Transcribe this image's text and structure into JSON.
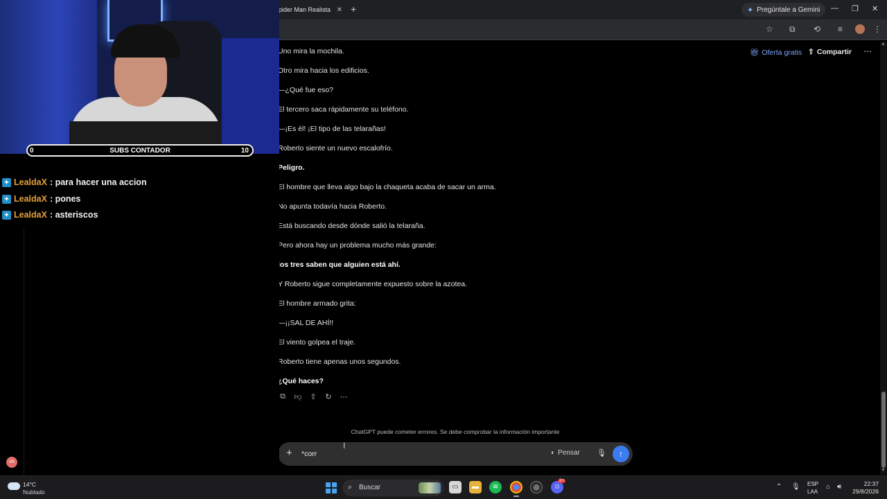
{
  "browser": {
    "tab_title": "pider Man Realista",
    "tab_close": "✕",
    "new_tab": "+",
    "gemini_label": "Pregúntale a Gemini",
    "minimize": "—",
    "maximize": "❐",
    "close": "✕"
  },
  "chat_page": {
    "header": {
      "offer_label": "Oferta gratis",
      "share_label": "Compartir",
      "more_label": "⋯"
    },
    "story_lines": [
      {
        "text": "Uno mira la mochila.",
        "bold": false
      },
      {
        "text": "Otro mira hacia los edificios.",
        "bold": false
      },
      {
        "text": "—¿Qué fue eso?",
        "bold": false
      },
      {
        "text": "El tercero saca rápidamente su teléfono.",
        "bold": false
      },
      {
        "text": "—¡Es él! ¡El tipo de las telarañas!",
        "bold": false
      },
      {
        "text": "Roberto siente un nuevo escalofrío.",
        "bold": false
      },
      {
        "text": "Peligro.",
        "bold": true
      },
      {
        "text": "El hombre que lleva algo bajo la chaqueta acaba de sacar un arma.",
        "bold": false
      },
      {
        "text": "No apunta todavía hacia Roberto.",
        "bold": false
      },
      {
        "text": "Está buscando desde dónde salió la telaraña.",
        "bold": false
      },
      {
        "text": "Pero ahora hay un problema mucho más grande:",
        "bold": false
      },
      {
        "text": "los tres saben que alguien está ahí.",
        "bold": true
      },
      {
        "text": "Y Roberto sigue completamente expuesto sobre la azotea.",
        "bold": false
      },
      {
        "text": "El hombre armado grita:",
        "bold": false
      },
      {
        "text": "—¡¡SAL DE AHÍ!!",
        "bold": false
      },
      {
        "text": "El viento golpea el traje.",
        "bold": false
      },
      {
        "text": "Roberto tiene apenas unos segundos.",
        "bold": false
      },
      {
        "text": "¿Qué haces?",
        "bold": true
      }
    ],
    "disclaimer": "ChatGPT puede cometer errores. Se debe comprobar la información importante",
    "composer": {
      "plus": "+",
      "value": "*corr",
      "think_label": "Pensar",
      "send": "↑"
    }
  },
  "stream": {
    "subs": {
      "min": "0",
      "title": "SUBS CONTADOR",
      "max": "10",
      "current_fraction": 0.0
    },
    "chat": [
      {
        "user": "LealdaX",
        "text": ": para hacer una accion"
      },
      {
        "user": "LealdaX",
        "text": ": pones"
      },
      {
        "user": "LealdaX",
        "text": ": asteriscos"
      }
    ],
    "avatar_label": "VA"
  },
  "taskbar": {
    "weather_temp": "14°C",
    "weather_desc": "Nublado",
    "search_label": "Buscar",
    "lang_1": "ESP",
    "lang_2": "LAA",
    "time": "22:37",
    "date": "29/8/2026",
    "discord_badge": "2+"
  },
  "colors": {
    "accent_blue": "#3b7df0",
    "username": "#e3a13a",
    "offer": "#7aa7ff"
  }
}
